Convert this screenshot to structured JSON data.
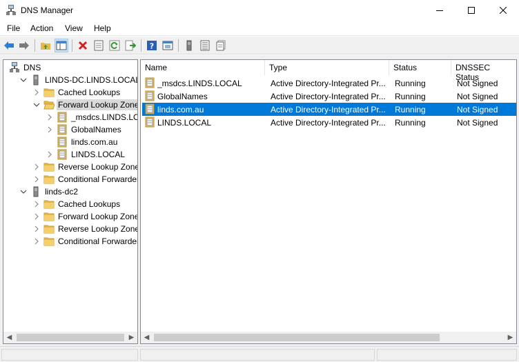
{
  "window": {
    "title": "DNS Manager"
  },
  "menu": [
    "File",
    "Action",
    "View",
    "Help"
  ],
  "toolbar": [
    "back-icon",
    "forward-icon",
    "up-folder-icon",
    "show-hide-tree-icon",
    "delete-icon",
    "properties-icon",
    "refresh-icon",
    "export-list-icon",
    "help-icon",
    "console-icon",
    "server-icon",
    "list-icon",
    "detail-icon"
  ],
  "tree": [
    {
      "label": "DNS",
      "icon": "dns-icon",
      "level": 0,
      "expander": ""
    },
    {
      "label": "LINDS-DC.LINDS.LOCAL",
      "icon": "server-icon",
      "level": 1,
      "expander": "open"
    },
    {
      "label": "Cached Lookups",
      "icon": "folder-icon",
      "level": 2,
      "expander": "closed"
    },
    {
      "label": "Forward Lookup Zones",
      "icon": "folder-open-icon",
      "level": 2,
      "expander": "open",
      "selected": true
    },
    {
      "label": "_msdcs.LINDS.LOCAL",
      "icon": "zone-icon",
      "level": 3,
      "expander": "closed"
    },
    {
      "label": "GlobalNames",
      "icon": "zone-icon",
      "level": 3,
      "expander": "closed"
    },
    {
      "label": "linds.com.au",
      "icon": "zone-icon",
      "level": 3,
      "expander": ""
    },
    {
      "label": "LINDS.LOCAL",
      "icon": "zone-icon",
      "level": 3,
      "expander": "closed"
    },
    {
      "label": "Reverse Lookup Zones",
      "icon": "folder-icon",
      "level": 2,
      "expander": "closed"
    },
    {
      "label": "Conditional Forwarders",
      "icon": "folder-icon",
      "level": 2,
      "expander": "closed"
    },
    {
      "label": "linds-dc2",
      "icon": "server-icon",
      "level": 1,
      "expander": "open"
    },
    {
      "label": "Cached Lookups",
      "icon": "folder-icon",
      "level": 2,
      "expander": "closed"
    },
    {
      "label": "Forward Lookup Zones",
      "icon": "folder-icon",
      "level": 2,
      "expander": "closed"
    },
    {
      "label": "Reverse Lookup Zones",
      "icon": "folder-icon",
      "level": 2,
      "expander": "closed"
    },
    {
      "label": "Conditional Forwarders",
      "icon": "folder-icon",
      "level": 2,
      "expander": "closed"
    }
  ],
  "list": {
    "columns": [
      "Name",
      "Type",
      "Status",
      "DNSSEC Status"
    ],
    "rows": [
      {
        "name": "_msdcs.LINDS.LOCAL",
        "type": "Active Directory-Integrated Pr...",
        "status": "Running",
        "dnssec": "Not Signed"
      },
      {
        "name": "GlobalNames",
        "type": "Active Directory-Integrated Pr...",
        "status": "Running",
        "dnssec": "Not Signed"
      },
      {
        "name": "linds.com.au",
        "type": "Active Directory-Integrated Pr...",
        "status": "Running",
        "dnssec": "Not Signed",
        "selected": true
      },
      {
        "name": "LINDS.LOCAL",
        "type": "Active Directory-Integrated Pr...",
        "status": "Running",
        "dnssec": "Not Signed"
      }
    ]
  },
  "colors": {
    "selection": "#0078d7",
    "tree_selection": "#d9d9d9",
    "folder": "#e8b84a"
  }
}
